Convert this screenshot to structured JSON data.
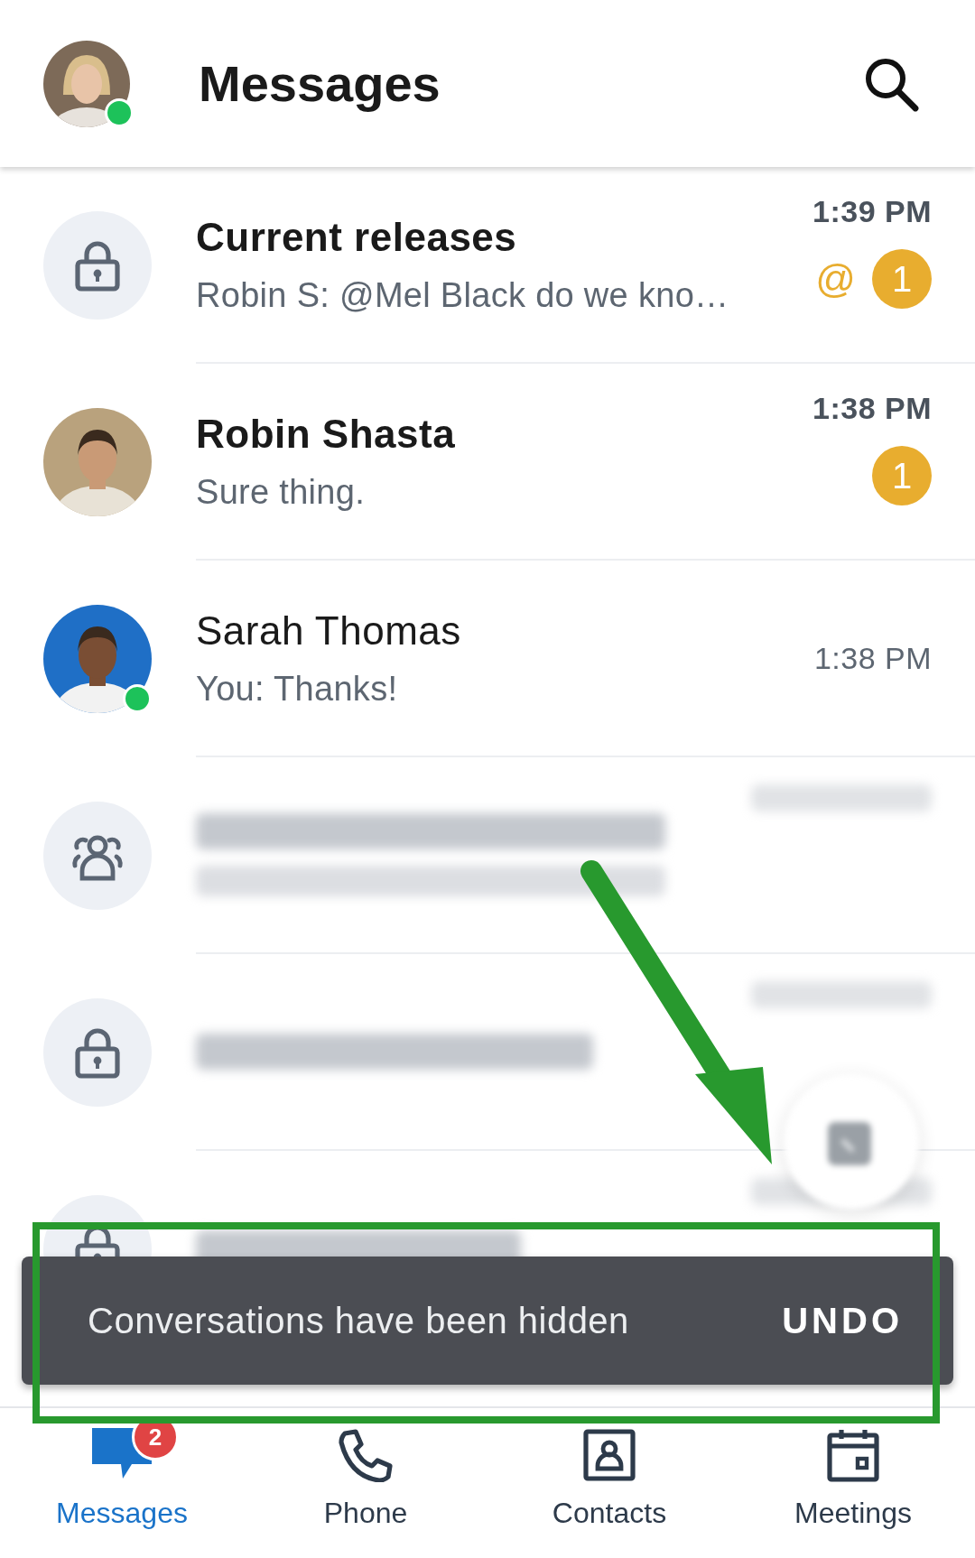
{
  "header": {
    "title": "Messages",
    "user_online": true
  },
  "conversations": [
    {
      "kind": "lock",
      "online": false,
      "title": "Current releases",
      "preview": "Robin S: @Mel Black do we kno…",
      "time": "1:39 PM",
      "unread": true,
      "mention": "@",
      "count": "1"
    },
    {
      "online": false,
      "title": "Robin Shasta",
      "preview": "Sure thing.",
      "time": "1:38 PM",
      "unread": true,
      "count": "1"
    },
    {
      "online": true,
      "title": "Sarah Thomas",
      "preview": "You: Thanks!",
      "time": "1:38 PM",
      "unread": false
    }
  ],
  "blurred_conversations": [
    {
      "kind": "group",
      "preview_shown": true
    },
    {
      "kind": "lock",
      "preview_shown": false
    },
    {
      "kind": "lock",
      "preview_shown": false
    }
  ],
  "snackbar": {
    "message": "Conversations have been hidden",
    "action": "UNDO"
  },
  "tabs": [
    {
      "label": "Messages",
      "kind": "chat",
      "selected": true,
      "badge": "2"
    },
    {
      "label": "Phone",
      "kind": "phone",
      "selected": false
    },
    {
      "label": "Contacts",
      "kind": "contact",
      "selected": false
    },
    {
      "label": "Meetings",
      "kind": "calendar",
      "selected": false
    }
  ]
}
